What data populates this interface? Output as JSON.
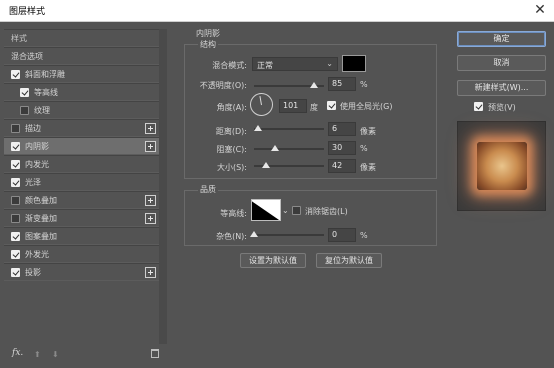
{
  "window": {
    "title": "图层样式",
    "close_glyph": "✕"
  },
  "left_panel": {
    "header": "样式",
    "blend_options": "混合选项",
    "items": [
      {
        "label": "斜面和浮雕",
        "checked": true,
        "has_plus": false,
        "indent": false
      },
      {
        "label": "等高线",
        "checked": true,
        "has_plus": false,
        "indent": true
      },
      {
        "label": "纹理",
        "checked": false,
        "has_plus": false,
        "indent": true
      },
      {
        "label": "描边",
        "checked": false,
        "has_plus": true,
        "indent": false
      },
      {
        "label": "内阴影",
        "checked": true,
        "has_plus": true,
        "indent": false,
        "selected": true
      },
      {
        "label": "内发光",
        "checked": true,
        "has_plus": false,
        "indent": false
      },
      {
        "label": "光泽",
        "checked": true,
        "has_plus": false,
        "indent": false
      },
      {
        "label": "颜色叠加",
        "checked": false,
        "has_plus": true,
        "indent": false
      },
      {
        "label": "渐变叠加",
        "checked": false,
        "has_plus": true,
        "indent": false
      },
      {
        "label": "图案叠加",
        "checked": true,
        "has_plus": false,
        "indent": false
      },
      {
        "label": "外发光",
        "checked": true,
        "has_plus": false,
        "indent": false
      },
      {
        "label": "投影",
        "checked": true,
        "has_plus": true,
        "indent": false
      }
    ],
    "fx_label": "fx.",
    "up_glyph": "⬆",
    "down_glyph": "⬇"
  },
  "inner_shadow": {
    "title": "内阴影",
    "structure": {
      "title": "结构",
      "blend_mode_label": "混合模式:",
      "blend_mode_value": "正常",
      "shadow_color": "#000000",
      "opacity_label": "不透明度(O):",
      "opacity_value": "85",
      "opacity_unit": "%",
      "opacity_level": 0.85,
      "angle_label": "角度(A):",
      "angle_value": "101",
      "angle_unit": "度",
      "global_light_label": "使用全局光(G)",
      "global_light_checked": true,
      "distance_label": "距离(D):",
      "distance_value": "6",
      "distance_unit": "像素",
      "distance_level": 0.05,
      "choke_label": "阻塞(C):",
      "choke_value": "30",
      "choke_unit": "%",
      "choke_level": 0.3,
      "size_label": "大小(S):",
      "size_value": "42",
      "size_unit": "像素",
      "size_level": 0.17
    },
    "quality": {
      "title": "品质",
      "contour_label": "等高线:",
      "antialias_label": "消除锯齿(L)",
      "antialias_checked": false,
      "noise_label": "杂色(N):",
      "noise_value": "0",
      "noise_unit": "%",
      "noise_level": 0
    },
    "set_default": "设置为默认值",
    "reset_default": "复位为默认值"
  },
  "right_panel": {
    "ok": "确定",
    "cancel": "取消",
    "new_style": "新建样式(W)...",
    "preview_label": "预览(V)",
    "preview_checked": true
  }
}
